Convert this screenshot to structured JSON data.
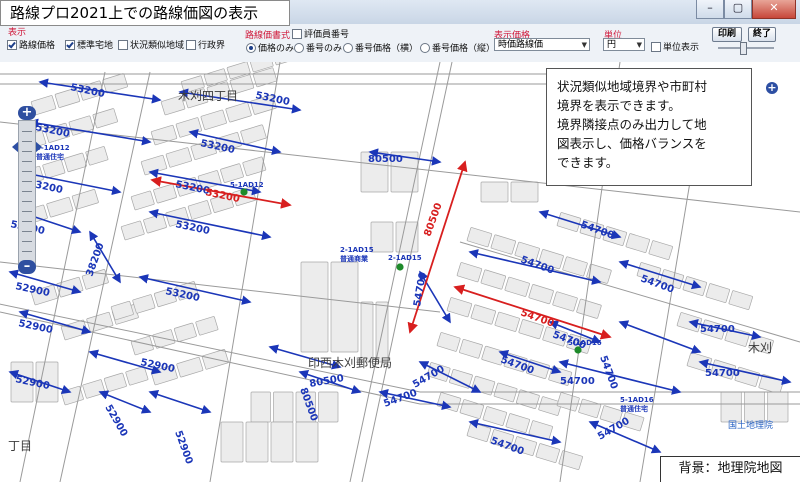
{
  "window": {
    "title": "路線プロ2021上での路線価図の表示",
    "minimize": "–",
    "maximize": "▢",
    "close": "✕"
  },
  "toolbar": {
    "display_group": "表示",
    "display_items": [
      {
        "label": "路線価格",
        "checked": true
      },
      {
        "label": "標準宅地",
        "checked": true
      },
      {
        "label": "状況類似地域",
        "checked": false
      },
      {
        "label": "行政界",
        "checked": false
      }
    ],
    "format_group": "路線価書式",
    "hyoukain_label": "評価員番号",
    "format_options": [
      {
        "label": "価格のみ",
        "selected": true
      },
      {
        "label": "番号のみ",
        "selected": false
      },
      {
        "label": "番号価格（横）",
        "selected": false
      },
      {
        "label": "番号価格（縦）",
        "selected": false
      }
    ],
    "price_group": "表示価格",
    "price_value": "時価路線価",
    "unit_group": "単位",
    "unit_value": "円",
    "unit_display_label": "単位表示",
    "print_label": "印刷",
    "exit_label": "終了"
  },
  "callout": {
    "lines": [
      "状況類似地域境界や市町村",
      "境界を表示できます。",
      "境界隣接点のみ出力して地",
      "図表示し、価格バランスを",
      "できます。"
    ]
  },
  "attribution": "背景：地理院地図",
  "map": {
    "place_labels": [
      "木刈四丁目",
      "印西木刈郵便局",
      "木刈",
      "丁目",
      "国土地理院"
    ],
    "route_prices_blue": [
      "53200",
      "53200",
      "53200",
      "53200",
      "53200",
      "53200",
      "53200",
      "53200",
      "53200",
      "52900",
      "52900",
      "52900",
      "52900",
      "52900",
      "52900",
      "80500",
      "80500",
      "80500",
      "54700",
      "54700",
      "54700",
      "54700",
      "54700",
      "54700",
      "54700",
      "54700",
      "54700",
      "54700",
      "54700",
      "54700",
      "54700",
      "54700",
      "38200"
    ],
    "route_prices_red": [
      "53200",
      "54700",
      "80500"
    ],
    "parcels": [
      {
        "code": "5-1AD12",
        "name": "普通住宅"
      },
      {
        "code": "5-1AD12",
        "name": ""
      },
      {
        "code": "2-1AD15",
        "name": "普通商業"
      },
      {
        "code": "2-1AD15",
        "name": ""
      },
      {
        "code": "5-1AD16",
        "name": "普通住宅"
      },
      {
        "code": "5-1AD16",
        "name": ""
      }
    ]
  }
}
